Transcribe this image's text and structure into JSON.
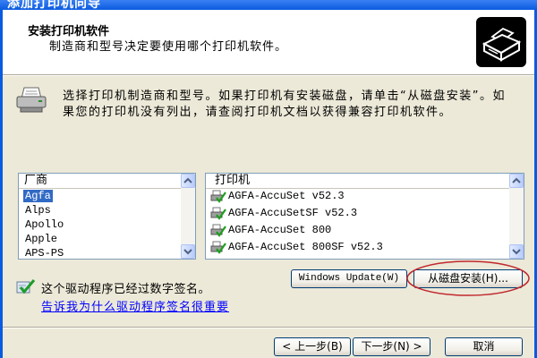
{
  "window": {
    "title": "添加打印机向导"
  },
  "header": {
    "title": "安装打印机软件",
    "subtitle": "制造商和型号决定要使用哪个打印机软件。",
    "icon": "printer-box-icon"
  },
  "instructions": {
    "icon": "printer-icon",
    "lines": [
      "选择打印机制造商和型号。如果打印机有安装磁盘，请单击“从磁盘安装”。如",
      "果您的打印机没有列出，请查阅打印机文档以获得兼容打印机软件。"
    ]
  },
  "manufacturers": {
    "header": "厂商",
    "items": [
      "Agfa",
      "Alps",
      "Apollo",
      "Apple",
      "APS-PS"
    ],
    "selected_index": 0
  },
  "printers": {
    "header": "打印机",
    "item_icon": "signed-printer-icon",
    "items": [
      "AGFA-AccuSet v52.3",
      "AGFA-AccuSetSF v52.3",
      "AGFA-AccuSet 800",
      "AGFA-AccuSet 800SF v52.3"
    ]
  },
  "signature": {
    "icon": "signed-driver-icon",
    "text": "这个驱动程序已经过数字签名。",
    "link": "告诉我为什么驱动程序签名很重要"
  },
  "buttons": {
    "windows_update": "Windows Update(W)",
    "have_disk": "从磁盘安装(H)...",
    "back": "< 上一步(B)",
    "next": "下一步(N) >",
    "cancel": "取消"
  },
  "colors": {
    "title_bar": "#0A5BE0",
    "dialog_background": "#ECE9D8",
    "selection": "#316AC5",
    "link": "#0000FF",
    "highlight_circle": "#C1272D"
  }
}
